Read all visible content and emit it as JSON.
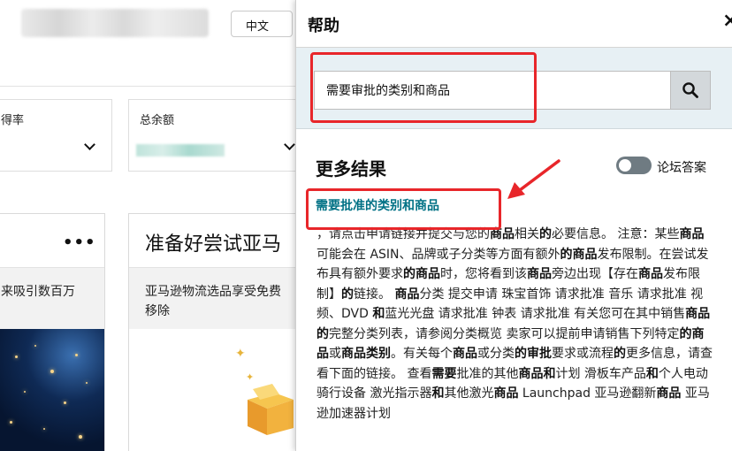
{
  "background": {
    "language_button": "中文",
    "metrics": [
      {
        "label": "得率"
      },
      {
        "label": "总余额"
      }
    ],
    "promo_card_left": {
      "menu": "•••",
      "text": "来吸引数百万"
    },
    "promo_card_right": {
      "title": "准备好尝试亚马",
      "text_line1": "亚马逊物流选品享受免费",
      "text_line2": "移除"
    }
  },
  "help_panel": {
    "title": "帮助",
    "close": "×",
    "search": {
      "value": "需要审批的类别和商品",
      "icon": "search-icon"
    },
    "results_title": "更多结果",
    "forum_toggle": {
      "label": "论坛答案",
      "on": false
    },
    "result": {
      "title": "需要批准的类别和商品",
      "snippet_segments": [
        {
          "t": "，请点击申请链接并提交与您的",
          "b": false
        },
        {
          "t": "商品",
          "b": true
        },
        {
          "t": "相关",
          "b": false
        },
        {
          "t": "的",
          "b": true
        },
        {
          "t": "必要信息。 注意：某些",
          "b": false
        },
        {
          "t": "商品",
          "b": true
        },
        {
          "t": "可能会在 ASIN、品牌或子分类等方面有额外",
          "b": false
        },
        {
          "t": "的商品",
          "b": true
        },
        {
          "t": "发布限制。在尝试发布具有额外要求",
          "b": false
        },
        {
          "t": "的商品",
          "b": true
        },
        {
          "t": "时，您将看到该",
          "b": false
        },
        {
          "t": "商品",
          "b": true
        },
        {
          "t": "旁边出现【存在",
          "b": false
        },
        {
          "t": "商品",
          "b": true
        },
        {
          "t": "发布限制】",
          "b": false
        },
        {
          "t": "的",
          "b": true
        },
        {
          "t": "链接。 ",
          "b": false
        },
        {
          "t": "商品",
          "b": true
        },
        {
          "t": "分类 提交申请 珠宝首饰 请求批准 音乐 请求批准 视频、DVD ",
          "b": false
        },
        {
          "t": "和",
          "b": true
        },
        {
          "t": "蓝光光盘 请求批准 钟表 请求批准 有关您可在其中销售",
          "b": false
        },
        {
          "t": "商品的",
          "b": true
        },
        {
          "t": "完整分类列表，请参阅分类概览 卖家可以提前申请销售下列特定",
          "b": false
        },
        {
          "t": "的商品",
          "b": true
        },
        {
          "t": "或",
          "b": false
        },
        {
          "t": "商品类别",
          "b": true
        },
        {
          "t": "。有关每个",
          "b": false
        },
        {
          "t": "商品",
          "b": true
        },
        {
          "t": "或分类",
          "b": false
        },
        {
          "t": "的审批",
          "b": true
        },
        {
          "t": "要求或流程",
          "b": false
        },
        {
          "t": "的",
          "b": true
        },
        {
          "t": "更多信息，请查看下面的链接。 查看",
          "b": false
        },
        {
          "t": "需要",
          "b": true
        },
        {
          "t": "批准的其他",
          "b": false
        },
        {
          "t": "商品和",
          "b": true
        },
        {
          "t": "计划 滑板车产品",
          "b": false
        },
        {
          "t": "和",
          "b": true
        },
        {
          "t": "个人电动骑行设备 激光指示器",
          "b": false
        },
        {
          "t": "和",
          "b": true
        },
        {
          "t": "其他激光",
          "b": false
        },
        {
          "t": "商品",
          "b": true
        },
        {
          "t": " Launchpad 亚马逊翻新",
          "b": false
        },
        {
          "t": "商品",
          "b": true
        },
        {
          "t": " 亚马逊加速器计划",
          "b": false
        }
      ]
    }
  },
  "colors": {
    "link": "#007185",
    "annotation": "#e8262a",
    "search_band": "#e7f0f4"
  }
}
